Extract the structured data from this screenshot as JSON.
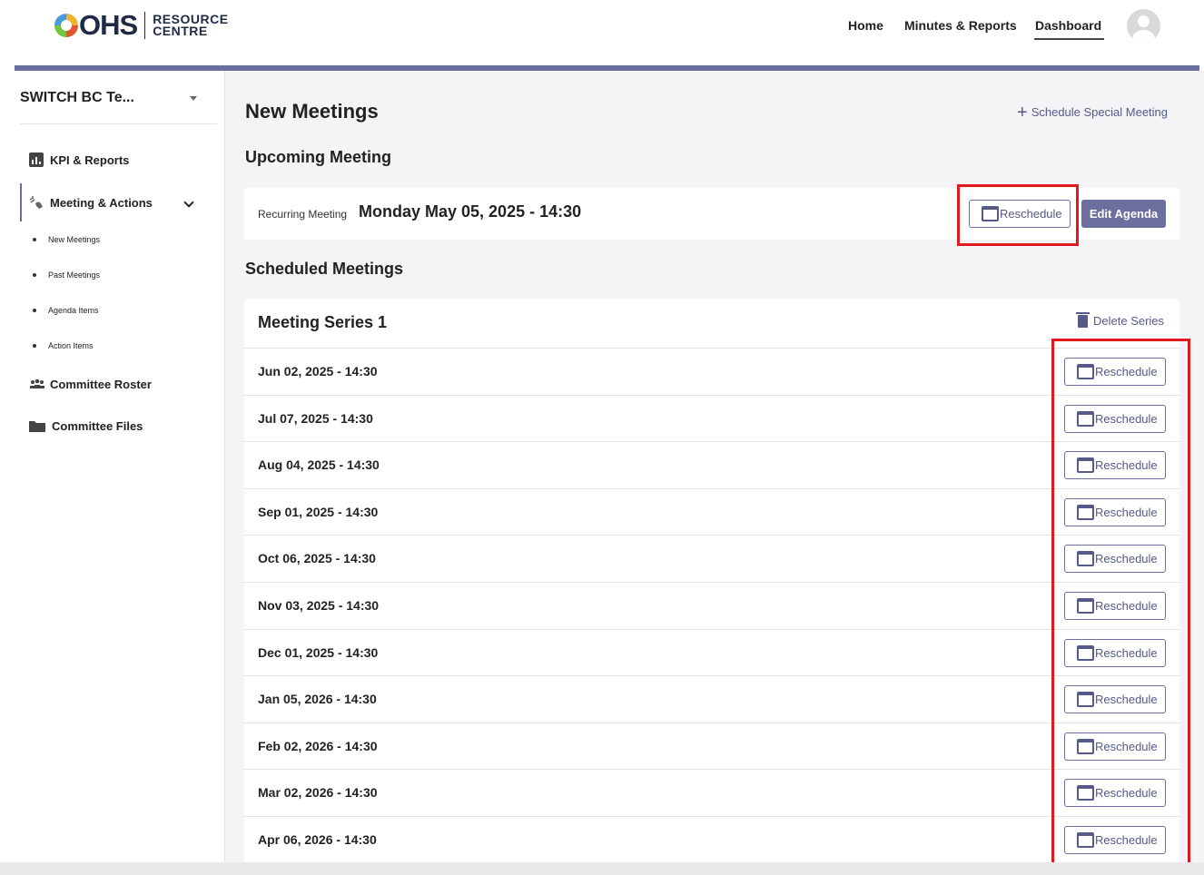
{
  "header": {
    "logo": {
      "main": "OHS",
      "sub_line1": "RESOURCE",
      "sub_line2": "CENTRE",
      "colors": [
        "#4a9bd6",
        "#f2b42c",
        "#7cc242",
        "#e4572e"
      ]
    },
    "nav": [
      {
        "label": "Home",
        "active": false
      },
      {
        "label": "Minutes & Reports",
        "active": false
      },
      {
        "label": "Dashboard",
        "active": true
      }
    ],
    "avatar_icon": "user-avatar-icon",
    "accent_color": "#6b6f9e"
  },
  "sidebar": {
    "org_select": "SWITCH BC Te...",
    "items": [
      {
        "label": "KPI & Reports",
        "icon": "bar-chart-icon"
      },
      {
        "label": "Meeting & Actions",
        "icon": "meeting-handshake-icon",
        "expanded": true
      },
      {
        "label": "Committee Roster",
        "icon": "people-group-icon"
      },
      {
        "label": "Committee Files",
        "icon": "folder-icon"
      }
    ],
    "subitems": [
      {
        "label": "New Meetings"
      },
      {
        "label": "Past Meetings"
      },
      {
        "label": "Agenda Items"
      },
      {
        "label": "Action Items"
      }
    ]
  },
  "main": {
    "title": "New Meetings",
    "schedule_special": "Schedule Special Meeting",
    "upcoming": {
      "heading": "Upcoming Meeting",
      "type": "Recurring Meeting",
      "date": "Monday May 05, 2025 - 14:30",
      "reschedule_label": "Reschedule",
      "edit_agenda_label": "Edit Agenda"
    },
    "scheduled": {
      "heading": "Scheduled Meetings",
      "series_title": "Meeting Series 1",
      "delete_label": "Delete Series",
      "reschedule_label": "Reschedule",
      "rows": [
        "Jun 02, 2025 - 14:30",
        "Jul 07, 2025 - 14:30",
        "Aug 04, 2025 - 14:30",
        "Sep 01, 2025 - 14:30",
        "Oct 06, 2025 - 14:30",
        "Nov 03, 2025 - 14:30",
        "Dec 01, 2025 - 14:30",
        "Jan 05, 2026 - 14:30",
        "Feb 02, 2026 - 14:30",
        "Mar 02, 2026 - 14:30",
        "Apr 06, 2026 - 14:30"
      ]
    }
  },
  "annotation_color": "#e0191d"
}
